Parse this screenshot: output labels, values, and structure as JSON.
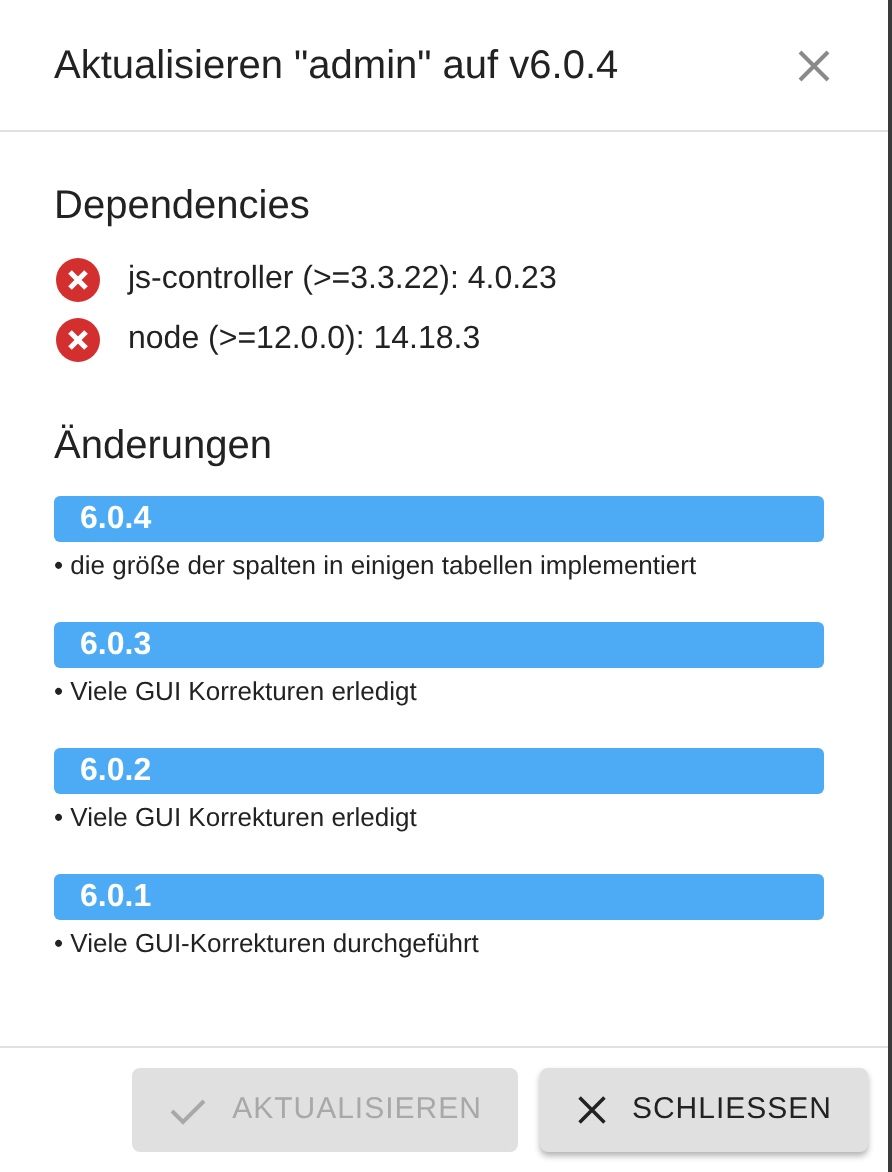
{
  "dialog": {
    "title": "Aktualisieren \"admin\" auf v6.0.4"
  },
  "dependencies": {
    "heading": "Dependencies",
    "items": [
      {
        "text": "js-controller (>=3.3.22): 4.0.23",
        "ok": false
      },
      {
        "text": "node (>=12.0.0): 14.18.3",
        "ok": false
      }
    ]
  },
  "changes": {
    "heading": "Änderungen",
    "versions": [
      {
        "version": "6.0.4",
        "notes": [
          "• die größe der spalten in einigen tabellen implementiert"
        ]
      },
      {
        "version": "6.0.3",
        "notes": [
          "• Viele GUI Korrekturen erledigt"
        ]
      },
      {
        "version": "6.0.2",
        "notes": [
          "• Viele GUI Korrekturen erledigt"
        ]
      },
      {
        "version": "6.0.1",
        "notes": [
          "• Viele GUI-Korrekturen durchgeführt"
        ]
      }
    ]
  },
  "buttons": [
    {
      "kind": "update",
      "label": "AKTUALISIEREN",
      "disabled": true
    },
    {
      "kind": "close",
      "label": "SCHLIESSEN",
      "disabled": false
    }
  ]
}
